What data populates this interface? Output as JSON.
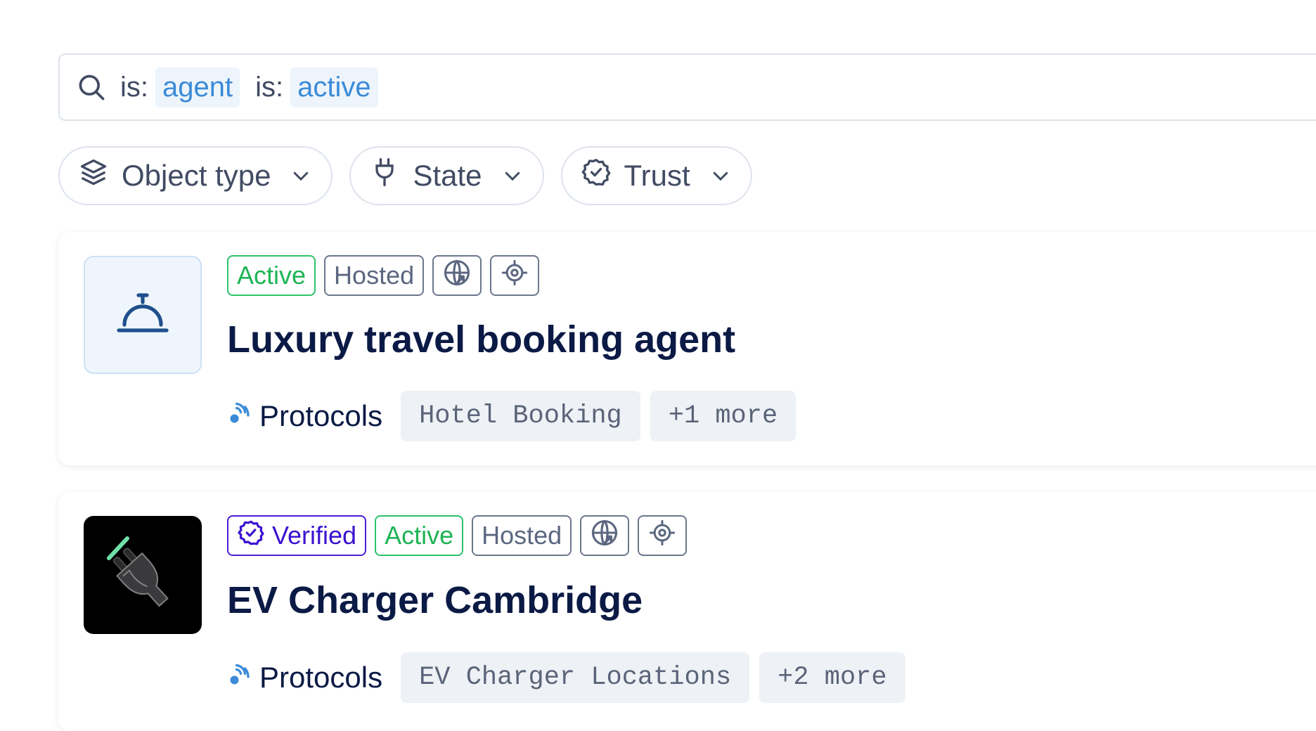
{
  "search": {
    "tokens": [
      {
        "prefix": "is:",
        "value": "agent"
      },
      {
        "prefix": "is:",
        "value": "active"
      }
    ]
  },
  "filters": [
    {
      "label": "Object type",
      "icon": "layers-icon"
    },
    {
      "label": "State",
      "icon": "plug-icon"
    },
    {
      "label": "Trust",
      "icon": "badge-check-icon"
    }
  ],
  "results": [
    {
      "title": "Luxury travel booking agent",
      "thumbnail_icon": "service-bell-icon",
      "badges": {
        "verified": null,
        "active": "Active",
        "hosted": "Hosted"
      },
      "protocols_label": "Protocols",
      "protocols": [
        "Hotel Booking",
        "+1 more"
      ]
    },
    {
      "title": "EV Charger Cambridge",
      "thumbnail_icon": "ev-plug-icon",
      "badges": {
        "verified": "Verified",
        "active": "Active",
        "hosted": "Hosted"
      },
      "protocols_label": "Protocols",
      "protocols": [
        "EV Charger Locations",
        "+2 more"
      ]
    }
  ],
  "colors": {
    "accent": "#3b8bd8",
    "active": "#1db454",
    "verified": "#3b12d0",
    "title": "#0b1a45"
  }
}
